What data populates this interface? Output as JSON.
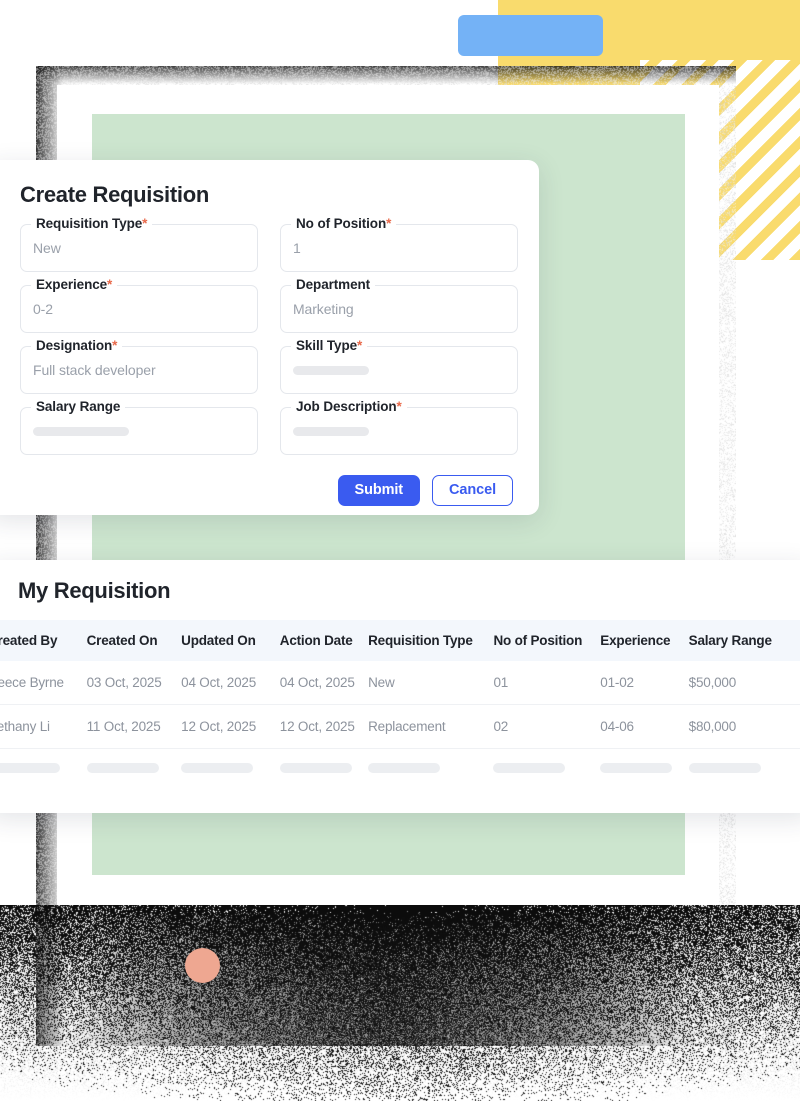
{
  "decor": {
    "yellow_color": "#F9DB6D",
    "blue_color": "#74B2F6",
    "green_panel_color": "#CCE5CE",
    "dot_color": "#EEA791"
  },
  "form": {
    "title": "Create Requisition",
    "fields": [
      {
        "label": "Requisition Type",
        "required": true,
        "value": "New",
        "empty": false
      },
      {
        "label": "No of Position",
        "required": true,
        "value": "1",
        "empty": false
      },
      {
        "label": "Experience",
        "required": true,
        "value": "0-2",
        "empty": false
      },
      {
        "label": "Department",
        "required": false,
        "value": "Marketing",
        "empty": false
      },
      {
        "label": "Designation",
        "required": true,
        "value": "Full stack developer",
        "empty": false
      },
      {
        "label": "Skill Type",
        "required": true,
        "value": "",
        "empty": true
      },
      {
        "label": "Salary Range",
        "required": false,
        "value": "",
        "empty": true
      },
      {
        "label": "Job Description",
        "required": true,
        "value": "",
        "empty": true
      }
    ],
    "submit_label": "Submit",
    "cancel_label": "Cancel",
    "submit_color": "#3A5BF0"
  },
  "table": {
    "title": "My Requisition",
    "columns": [
      "Created By",
      "Created On",
      "Updated On",
      "Action Date",
      "Requisition Type",
      "No of Position",
      "Experience",
      "Salary Range"
    ],
    "rows": [
      {
        "created_by": "Reece Byrne",
        "created_on": "03 Oct, 2025",
        "updated_on": "04 Oct, 2025",
        "action_date": "04 Oct, 2025",
        "requisition_type": "New",
        "no_of_position": "01",
        "experience": "01-02",
        "salary_range": "$50,000"
      },
      {
        "created_by": "Bethany Li",
        "created_on": "11 Oct, 2025",
        "updated_on": "12 Oct, 2025",
        "action_date": "12 Oct, 2025",
        "requisition_type": "Replacement",
        "no_of_position": "02",
        "experience": "04-06",
        "salary_range": "$80,000"
      }
    ],
    "placeholder_row": true
  }
}
